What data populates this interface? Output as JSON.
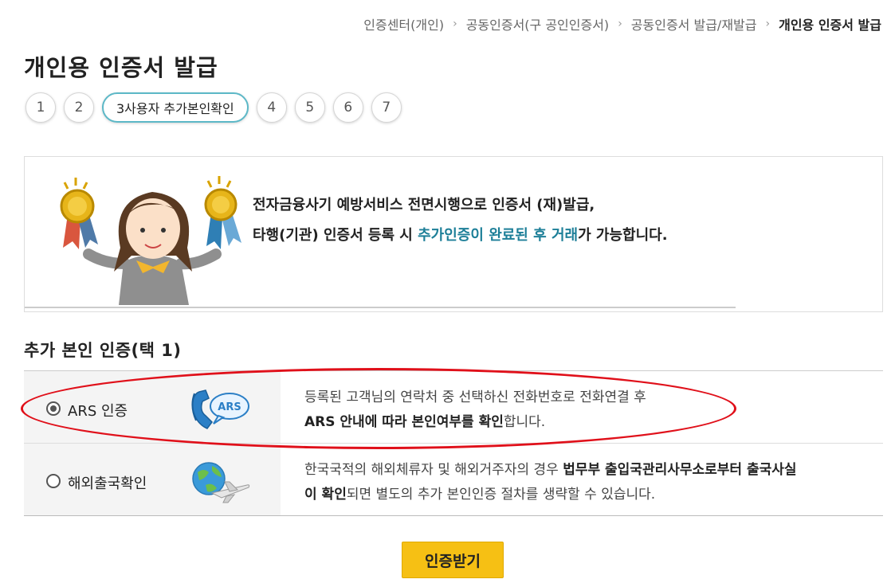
{
  "breadcrumb": {
    "items": [
      "인증센터(개인)",
      "공동인증서(구 공인인증서)",
      "공동인증서 발급/재발급"
    ],
    "current": "개인용 인증서 발급"
  },
  "page": {
    "title": "개인용 인증서 발급"
  },
  "steps": {
    "items": [
      "1",
      "2",
      "3사용자 추가본인확인",
      "4",
      "5",
      "6",
      "7"
    ],
    "active_index": 2
  },
  "banner": {
    "line1": "전자금융사기 예방서비스 전면시행으로 인증서 (재)발급,",
    "line2_a": "타행(기관) 인증서 등록 시 ",
    "line2_hl1": "추가인증이 완료된",
    "line2_b": " ",
    "line2_hl2": "후 거래",
    "line2_c": "가 가능합니다."
  },
  "section": {
    "title": "추가 본인 인증(택 1)"
  },
  "options": [
    {
      "label": "ARS 인증",
      "checked": true,
      "icon": "phone-ars-icon",
      "desc_line1": "등록된 고객님의 연락처 중 선택하신 전화번호로 전화연결 후",
      "desc_line2_bold": "ARS 안내에 따라 본인여부를 확인",
      "desc_line2_rest": "합니다."
    },
    {
      "label": "해외출국확인",
      "checked": false,
      "icon": "globe-airplane-icon",
      "desc_line1_a": "한국국적의 해외체류자 및 해외거주자의 경우 ",
      "desc_line1_bold": "법무부 출입국관리사무소로부터 출국사실",
      "desc_line2_bold": "이 확인",
      "desc_line2_rest": "되면 별도의 추가 본인인증 절차를 생략할 수 있습니다."
    }
  ],
  "icons": {
    "ars_badge": "ARS"
  },
  "cta": {
    "label": "인증받기"
  },
  "colors": {
    "accent": "#1d7f98",
    "step_active_border": "#5cb8c7",
    "cta_bg": "#f6c014",
    "annotation_red": "#e0101a"
  }
}
